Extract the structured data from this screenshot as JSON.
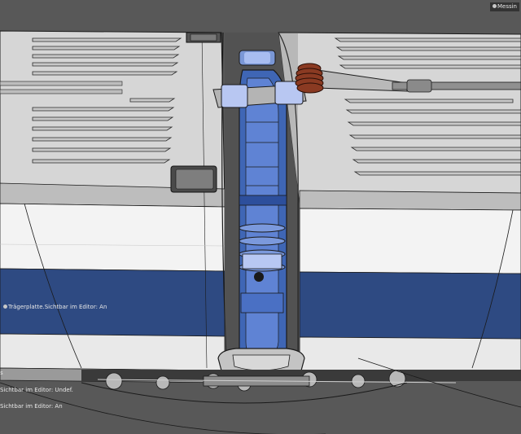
{
  "viewport": {
    "labels": {
      "top_right": "Messin",
      "traeger": "Trägerplatte.Sichtbar im Editor: An",
      "left_s": "s",
      "left_undef": "Sichtbar im Editor: Undef.",
      "left_an": "Sichtbar im Editor: An"
    }
  },
  "colors": {
    "background": "#585858",
    "roof": "#d8d8d8",
    "body_white": "#f4f4f4",
    "stripe_blue": "#2e4a82",
    "coupler_blue": "#3f66b5",
    "spring_copper": "#8a3a22",
    "wire": "#1a1a1a"
  },
  "icons": [
    "object-dot-icon"
  ]
}
